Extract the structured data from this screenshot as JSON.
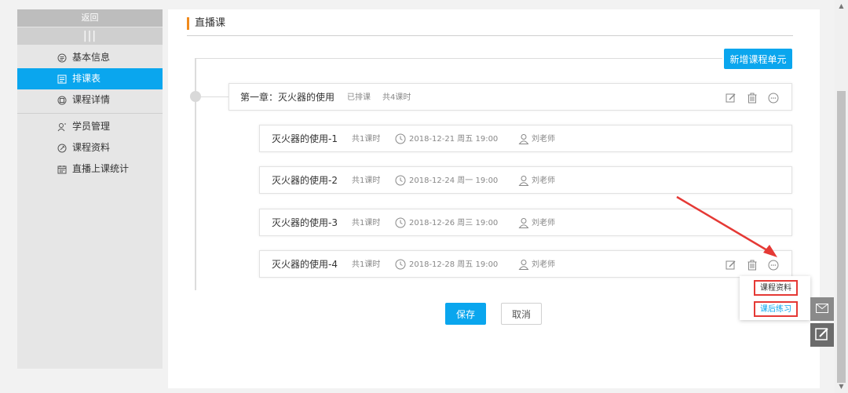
{
  "sidebar": {
    "back_label": "返回",
    "collapse_label": "|||",
    "groups": [
      [
        {
          "label": "基本信息",
          "icon": "info-circle-icon"
        },
        {
          "label": "排课表",
          "icon": "schedule-icon"
        },
        {
          "label": "课程详情",
          "icon": "detail-icon"
        }
      ],
      [
        {
          "label": "学员管理",
          "icon": "users-icon"
        },
        {
          "label": "课程资料",
          "icon": "attachment-icon"
        },
        {
          "label": "直播上课统计",
          "icon": "calendar-icon"
        }
      ]
    ],
    "active": "排课表",
    "active_color": "#0aa6ee"
  },
  "header": {
    "title": "直播课",
    "accent_color": "#f08a1c"
  },
  "toolbar": {
    "add_unit_label": "新增课程单元"
  },
  "chapter": {
    "title": "第一章：灭火器的使用",
    "status": "已排课",
    "count": "共4课时"
  },
  "lessons": [
    {
      "title": "灭火器的使用-1",
      "count": "共1课时",
      "datetime": "2018-12-21 周五 19:00",
      "teacher": "刘老师"
    },
    {
      "title": "灭火器的使用-2",
      "count": "共1课时",
      "datetime": "2018-12-24 周一 19:00",
      "teacher": "刘老师"
    },
    {
      "title": "灭火器的使用-3",
      "count": "共1课时",
      "datetime": "2018-12-26 周三 19:00",
      "teacher": "刘老师"
    },
    {
      "title": "灭火器的使用-4",
      "count": "共1课时",
      "datetime": "2018-12-28 周五 19:00",
      "teacher": "刘老师"
    }
  ],
  "dropdown": {
    "items": [
      "课程资料",
      "课后练习"
    ],
    "highlight_color": "#e53935"
  },
  "footer": {
    "save_label": "保存",
    "cancel_label": "取消"
  },
  "primary_color": "#0aa6ee"
}
